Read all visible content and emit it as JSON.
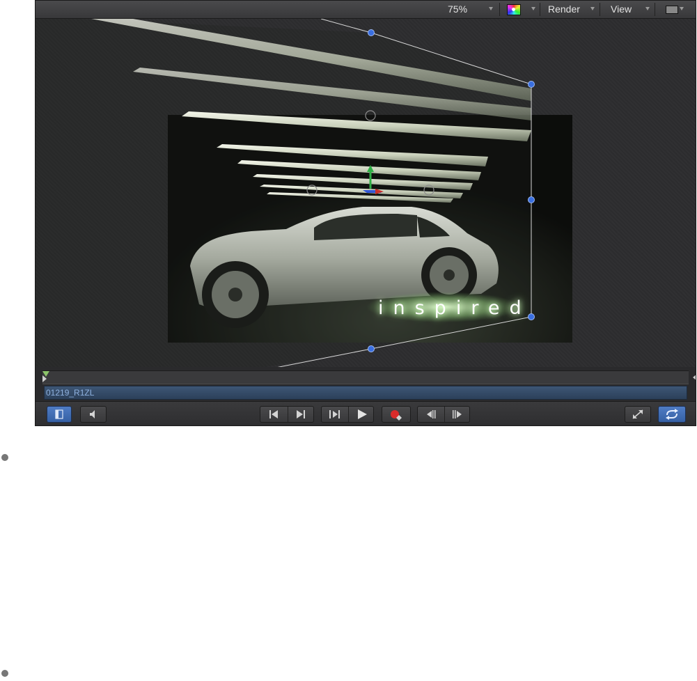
{
  "toolbar": {
    "zoom": "75%",
    "render_label": "Render",
    "view_label": "View"
  },
  "canvas": {
    "overlay_text": "inspired"
  },
  "timeline": {
    "clip_name": "01219_R1ZL"
  },
  "colors": {
    "accent": "#3a6fd0",
    "handle": "#3a6fe0",
    "panel": "#2a2a2c"
  },
  "icons": {
    "layers_toggle": "layers-panel-icon",
    "audio": "speaker-icon",
    "goto_start": "go-to-start-icon",
    "goto_end": "go-to-end-icon",
    "play_from_start": "play-from-start-icon",
    "play": "play-icon",
    "record": "record-icon",
    "prev_frame": "previous-frame-icon",
    "next_frame": "next-frame-icon",
    "fullscreen": "fullscreen-icon",
    "loop": "loop-icon"
  }
}
